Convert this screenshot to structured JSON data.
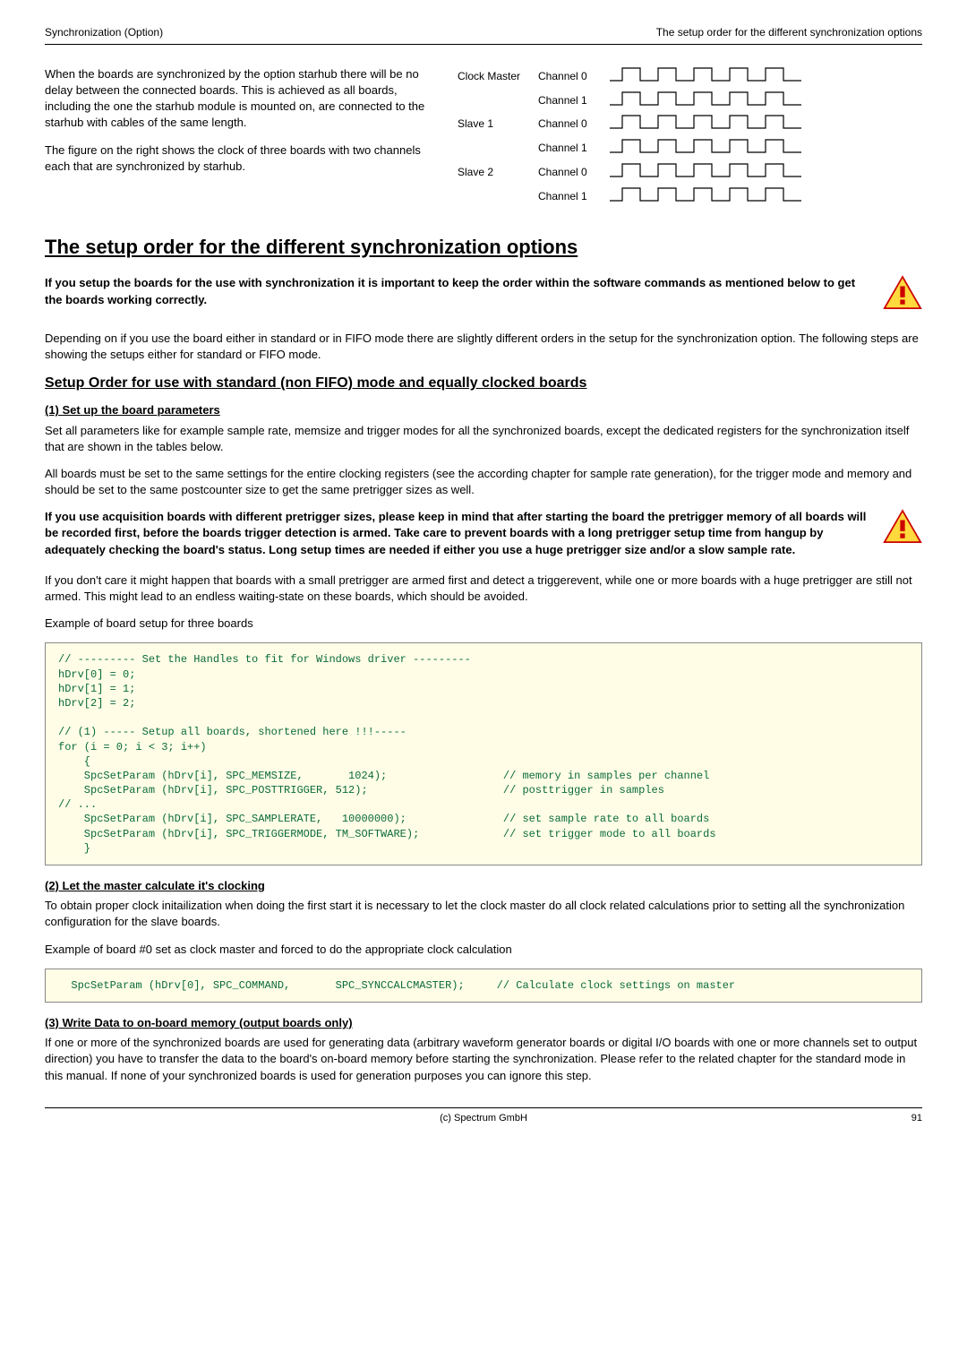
{
  "header": {
    "left": "Synchronization (Option)",
    "right": "The setup order for the different synchronization options"
  },
  "intro": {
    "p1": "When the boards are synchronized by the option starhub there will be no delay between the connected boards. This is achieved as all boards, including the one the starhub module is mounted on, are connected to the starhub with cables of the same length.",
    "p2": "The figure on the right shows the clock of three boards with two channels each that are synchronized by starhub."
  },
  "clock": {
    "rows": [
      {
        "left": "Clock Master",
        "right": "Channel 0"
      },
      {
        "left": "",
        "right": "Channel 1"
      },
      {
        "left": "Slave 1",
        "right": "Channel 0"
      },
      {
        "left": "",
        "right": "Channel 1"
      },
      {
        "left": "Slave 2",
        "right": "Channel 0"
      },
      {
        "left": "",
        "right": "Channel 1"
      }
    ]
  },
  "h1": "The setup order for the different synchronization options",
  "warn1": "If you setup the boards for the use with synchronization it is important to keep the order within the software commands as mentioned below to get the boards working correctly.",
  "p3": "Depending on if you use the board either in standard or in FIFO mode there are slightly different orders in the setup for the synchronization option. The following steps are showing the setups either for standard or FIFO mode.",
  "h2": "Setup Order for use with standard (non FIFO) mode and equally clocked boards",
  "step1": {
    "title": "(1) Set up the board parameters",
    "p1": "Set all parameters like for example sample rate, memsize and trigger modes for all the synchronized boards, except the dedicated registers for the synchronization itself that are shown in the tables below.",
    "p2": "All boards must be set to the same settings for the entire clocking registers (see the according chapter for sample rate generation), for the trigger mode and memory and should be set to the same postcounter size to get the same pretrigger sizes as well."
  },
  "warn2": "If you use acquisition boards with different pretrigger sizes, please keep in mind that after starting the board the pretrigger memory of all boards will be recorded first, before the boards trigger detection is armed. Take care to prevent boards with a long pretrigger setup time from hangup by adequately checking the board's status. Long setup times are needed if either you use a huge pretrigger size and/or a slow sample rate.",
  "p4": "If you don't care it might happen that boards with a small pretrigger are armed first and detect a triggerevent, while one or more boards with a huge pretrigger are still not armed. This might lead to an endless waiting-state on these boards, which should be avoided.",
  "p5": "Example of board setup for three boards",
  "code1": "// --------- Set the Handles to fit for Windows driver ---------\nhDrv[0] = 0;\nhDrv[1] = 1;\nhDrv[2] = 2;\n\n// (1) ----- Setup all boards, shortened here !!!-----\nfor (i = 0; i < 3; i++)\n    {\n    SpcSetParam (hDrv[i], SPC_MEMSIZE,       1024);                  // memory in samples per channel\n    SpcSetParam (hDrv[i], SPC_POSTTRIGGER, 512);                     // posttrigger in samples\n// ...\n    SpcSetParam (hDrv[i], SPC_SAMPLERATE,   10000000);               // set sample rate to all boards\n    SpcSetParam (hDrv[i], SPC_TRIGGERMODE, TM_SOFTWARE);             // set trigger mode to all boards\n    }",
  "step2": {
    "title": "(2) Let the master calculate it's clocking",
    "p1": "To obtain proper clock initailization when doing the first start it is necessary to let the clock master do all clock related calculations prior to setting all the synchronization configuration for the slave boards.",
    "p2": "Example of board #0 set as clock master and forced to do the appropriate clock calculation"
  },
  "code2": "  SpcSetParam (hDrv[0], SPC_COMMAND,       SPC_SYNCCALCMASTER);     // Calculate clock settings on master",
  "step3": {
    "title": "(3) Write Data to on-board memory (output boards only)",
    "p1": "If one or more of the synchronized boards are used for generating data (arbitrary waveform generator boards or digital I/O boards with one or more channels set to output direction) you have to transfer the data to the board's on-board memory before starting the synchronization. Please refer to the related chapter for the standard mode in this manual. If none of your synchronized boards is used for generation purposes you can ignore this step."
  },
  "footer": {
    "center": "(c) Spectrum GmbH",
    "right": "91"
  }
}
